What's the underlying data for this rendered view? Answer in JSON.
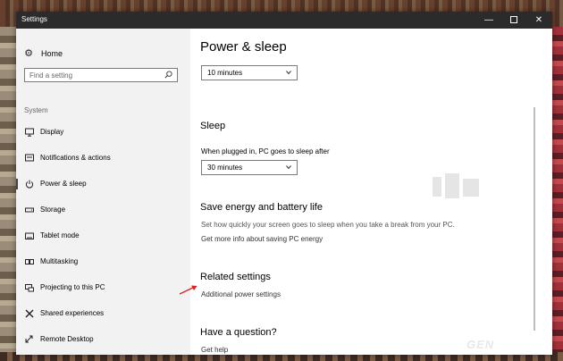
{
  "window": {
    "title": "Settings"
  },
  "titlebar_buttons": {
    "minimize": "—",
    "close": "✕"
  },
  "sidebar": {
    "home_label": "Home",
    "search_placeholder": "Find a setting",
    "section_label": "System",
    "items": [
      {
        "label": "Display",
        "icon": "monitor-icon"
      },
      {
        "label": "Notifications & actions",
        "icon": "notifications-icon"
      },
      {
        "label": "Power & sleep",
        "icon": "power-icon",
        "selected": true
      },
      {
        "label": "Storage",
        "icon": "storage-icon"
      },
      {
        "label": "Tablet mode",
        "icon": "tablet-icon"
      },
      {
        "label": "Multitasking",
        "icon": "multitasking-icon"
      },
      {
        "label": "Projecting to this PC",
        "icon": "projecting-icon"
      },
      {
        "label": "Shared experiences",
        "icon": "shared-experiences-icon"
      },
      {
        "label": "Remote Desktop",
        "icon": "remote-desktop-icon"
      }
    ]
  },
  "content": {
    "title": "Power & sleep",
    "screen_timeout_value": "10 minutes",
    "sleep": {
      "heading": "Sleep",
      "label": "When plugged in, PC goes to sleep after",
      "value": "30 minutes"
    },
    "save_energy": {
      "heading": "Save energy and battery life",
      "description": "Set how quickly your screen goes to sleep when you take a break from your PC.",
      "link": "Get more info about saving PC energy"
    },
    "related": {
      "heading": "Related settings",
      "link": "Additional power settings"
    },
    "question": {
      "heading": "Have a question?",
      "link": "Get help"
    }
  },
  "branding": {
    "logo_text": "GEN"
  },
  "colors": {
    "sidebar_bg": "#f2f2f2",
    "titlebar_bg": "#2b2b2b",
    "annotation_arrow": "#e02020"
  }
}
